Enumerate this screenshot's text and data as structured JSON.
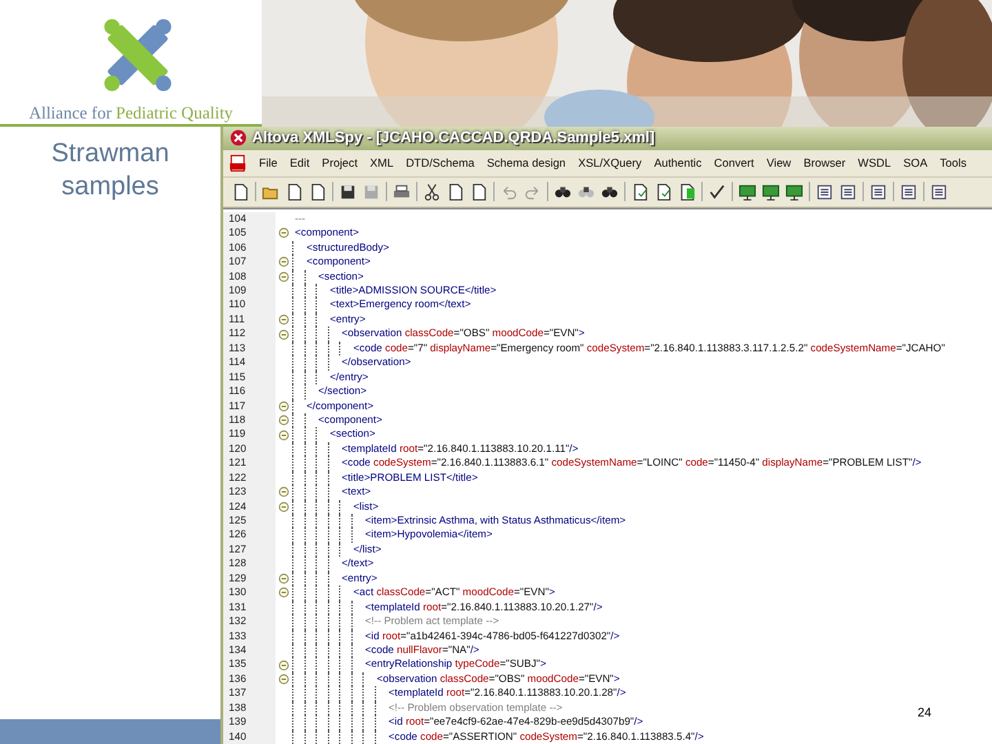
{
  "logo": {
    "name_parts": [
      "Alliance for",
      "Pediatric Quality"
    ]
  },
  "slide": {
    "title": "Strawman samples",
    "page_number": "24"
  },
  "window": {
    "title": "Altova XMLSpy - [JCAHO.CACCAD.QRDA.Sample5.xml]"
  },
  "menu": [
    "File",
    "Edit",
    "Project",
    "XML",
    "DTD/Schema",
    "Schema design",
    "XSL/XQuery",
    "Authentic",
    "Convert",
    "View",
    "Browser",
    "WSDL",
    "SOA",
    "Tools"
  ],
  "editor": {
    "lines": [
      {
        "num": "104",
        "text": "---",
        "kind": "comment"
      },
      {
        "num": "105",
        "text": "<component>",
        "kind": "tag",
        "children": [
          {
            "num": "106",
            "text": "<structuredBody>",
            "kind": "tag"
          },
          {
            "num": "107",
            "text": "<component>",
            "kind": "tag",
            "children": [
              {
                "num": "108",
                "text": "<section>",
                "kind": "tag",
                "children": [
                  {
                    "num": "109",
                    "text": "<title>ADMISSION SOURCE</title>",
                    "kind": "tag"
                  },
                  {
                    "num": "110",
                    "text": "<text>Emergency room</text>",
                    "kind": "tag"
                  },
                  {
                    "num": "111",
                    "text": "<entry>",
                    "kind": "tag",
                    "children": [
                      {
                        "num": "112",
                        "text": "<observation classCode=\"OBS\" moodCode=\"EVN\">",
                        "kind": "tag",
                        "children": [
                          {
                            "num": "113",
                            "text": "<code code=\"7\" displayName=\"Emergency room\" codeSystem=\"2.16.840.1.113883.3.117.1.2.5.2\" codeSystemName=\"JCAHO\"",
                            "kind": "tag"
                          }
                        ]
                      },
                      {
                        "num": "114",
                        "text": "</observation>",
                        "kind": "tag"
                      }
                    ]
                  },
                  {
                    "num": "115",
                    "text": "</entry>",
                    "kind": "tag"
                  }
                ]
              },
              {
                "num": "116",
                "text": "</section>",
                "kind": "tag"
              }
            ]
          },
          {
            "num": "117",
            "text": "</component>",
            "kind": "tag",
            "children": [
              {
                "num": "118",
                "text": "<component>",
                "kind": "tag",
                "children": [
                  {
                    "num": "119",
                    "text": "<section>",
                    "kind": "tag",
                    "children": [
                      {
                        "num": "120",
                        "text": "<templateId root=\"2.16.840.1.113883.10.20.1.11\"/>",
                        "kind": "tag"
                      },
                      {
                        "num": "121",
                        "text": "<code codeSystem=\"2.16.840.1.113883.6.1\" codeSystemName=\"LOINC\" code=\"11450-4\" displayName=\"PROBLEM LIST\"/>",
                        "kind": "tag"
                      },
                      {
                        "num": "122",
                        "text": "<title>PROBLEM LIST</title>",
                        "kind": "tag"
                      },
                      {
                        "num": "123",
                        "text": "<text>",
                        "kind": "tag",
                        "children": [
                          {
                            "num": "124",
                            "text": "<list>",
                            "kind": "tag",
                            "children": [
                              {
                                "num": "125",
                                "text": "<item>Extrinsic Asthma, with Status Asthmaticus</item>",
                                "kind": "tag"
                              },
                              {
                                "num": "126",
                                "text": "<item>Hypovolemia</item>",
                                "kind": "tag"
                              }
                            ]
                          },
                          {
                            "num": "127",
                            "text": "</list>",
                            "kind": "tag"
                          }
                        ]
                      },
                      {
                        "num": "128",
                        "text": "</text>",
                        "kind": "tag"
                      },
                      {
                        "num": "129",
                        "text": "<entry>",
                        "kind": "tag",
                        "children": [
                          {
                            "num": "130",
                            "text": "<act classCode=\"ACT\" moodCode=\"EVN\">",
                            "kind": "tag",
                            "children": [
                              {
                                "num": "131",
                                "text": "<templateId root=\"2.16.840.1.113883.10.20.1.27\"/>",
                                "kind": "tag"
                              },
                              {
                                "num": "132",
                                "text": "<!-- Problem act template -->",
                                "kind": "comment"
                              },
                              {
                                "num": "133",
                                "text": "<id root=\"a1b42461-394c-4786-bd05-f641227d0302\"/>",
                                "kind": "tag"
                              },
                              {
                                "num": "134",
                                "text": "<code nullFlavor=\"NA\"/>",
                                "kind": "tag"
                              },
                              {
                                "num": "135",
                                "text": "<entryRelationship typeCode=\"SUBJ\">",
                                "kind": "tag",
                                "children": [
                                  {
                                    "num": "136",
                                    "text": "<observation classCode=\"OBS\" moodCode=\"EVN\">",
                                    "kind": "tag",
                                    "children": [
                                      {
                                        "num": "137",
                                        "text": "<templateId root=\"2.16.840.1.113883.10.20.1.28\"/>",
                                        "kind": "tag"
                                      },
                                      {
                                        "num": "138",
                                        "text": "<!-- Problem observation template -->",
                                        "kind": "comment"
                                      },
                                      {
                                        "num": "139",
                                        "text": "<id root=\"ee7e4cf9-62ae-47e4-829b-ee9d5d4307b9\"/>",
                                        "kind": "tag"
                                      },
                                      {
                                        "num": "140",
                                        "text": "<code code=\"ASSERTION\" codeSystem=\"2.16.840.1.113883.5.4\"/>",
                                        "kind": "tag"
                                      }
                                    ]
                                  }
                                ]
                              }
                            ]
                          }
                        ]
                      }
                    ]
                  }
                ]
              }
            ]
          }
        ]
      }
    ]
  }
}
